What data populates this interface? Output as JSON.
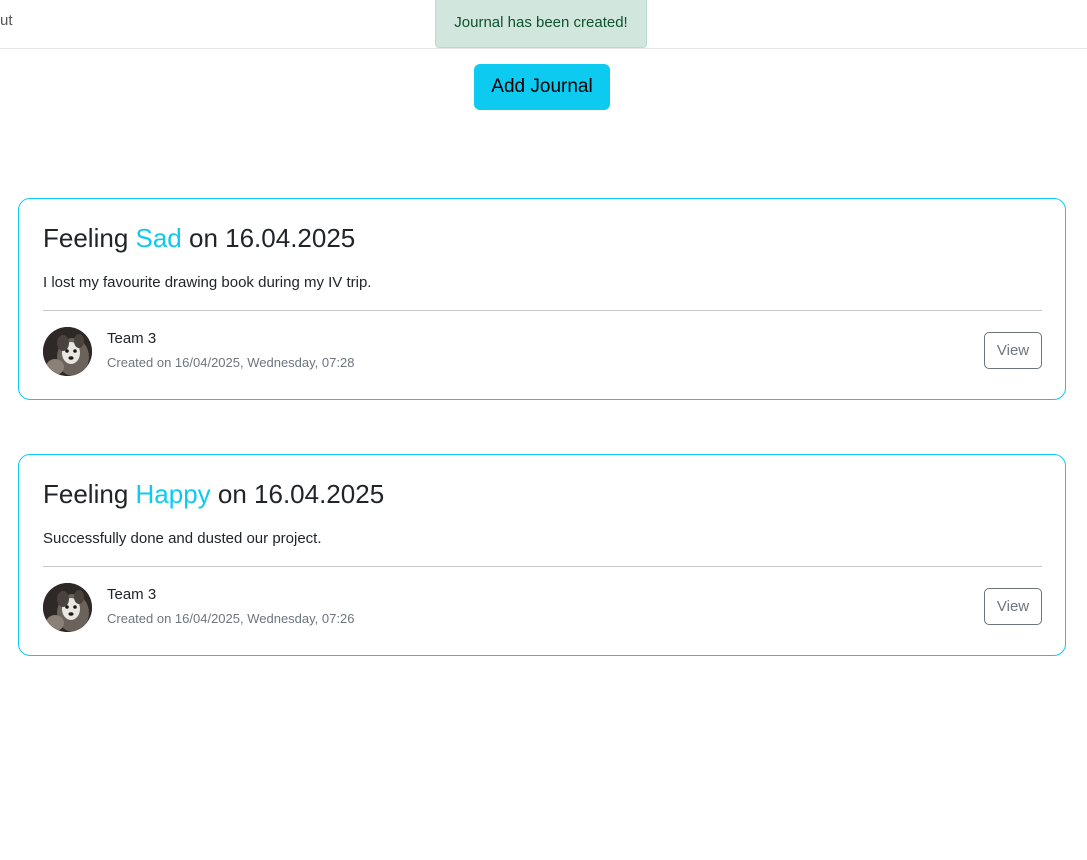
{
  "nav": {
    "fragment_text": "ut"
  },
  "toast": {
    "message": "Journal has been created!"
  },
  "actions": {
    "add_journal_label": "Add Journal"
  },
  "colors": {
    "accent": "#0dcaf0",
    "toast_bg": "#d1e7dd",
    "toast_text": "#0f5132"
  },
  "journals": [
    {
      "title_prefix": "Feeling ",
      "mood": "Sad",
      "title_suffix": " on 16.04.2025",
      "text": "I lost my favourite drawing book during my IV trip.",
      "author": "Team 3",
      "created": "Created on 16/04/2025, Wednesday, 07:28",
      "view_label": "View",
      "avatar_icon": "dog-photo-avatar"
    },
    {
      "title_prefix": "Feeling ",
      "mood": "Happy",
      "title_suffix": " on 16.04.2025",
      "text": "Successfully done and dusted our project.",
      "author": "Team 3",
      "created": "Created on 16/04/2025, Wednesday, 07:26",
      "view_label": "View",
      "avatar_icon": "dog-photo-avatar"
    }
  ]
}
